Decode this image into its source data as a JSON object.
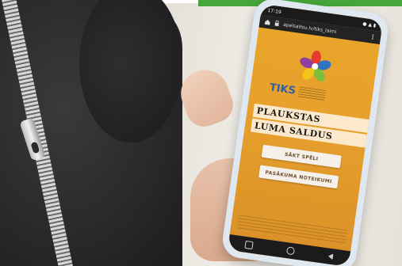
{
  "photo": {
    "accent_color": "#46a63a",
    "phone_screen_color": "#e8a12c"
  },
  "phone": {
    "status_time": "17:19",
    "status_icons": "● ▲ ▮",
    "url": "apelsaltsu.lv/tiks_laimi",
    "brand": "TIKS",
    "title_lines": [
      "PLAUKSTAS",
      "LUMA SALDUS"
    ],
    "buttons": {
      "start": "SĀKT SPĒLI",
      "rules": "PASĀKUMA NOTEIKUMI"
    }
  }
}
